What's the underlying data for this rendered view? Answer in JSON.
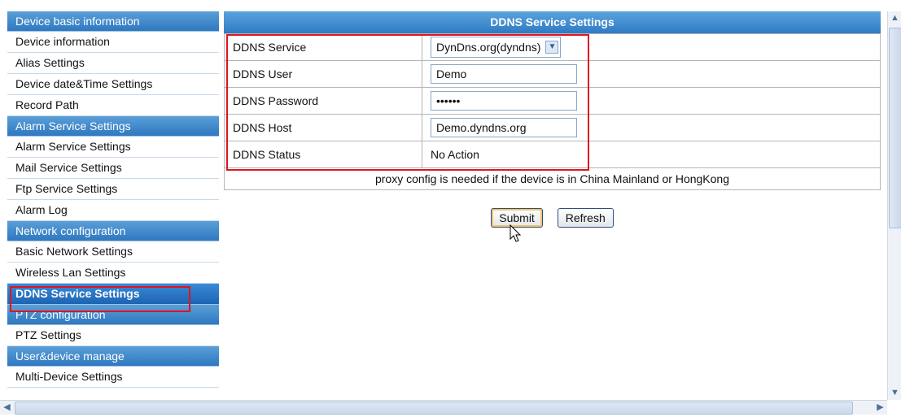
{
  "sidebar": {
    "sections": [
      {
        "header": "Device basic information",
        "items": [
          "Device information",
          "Alias Settings",
          "Device date&Time Settings",
          "Record Path"
        ]
      },
      {
        "header": "Alarm Service Settings",
        "items": [
          "Alarm Service Settings",
          "Mail Service Settings",
          "Ftp Service Settings",
          "Alarm Log"
        ]
      },
      {
        "header": "Network configuration",
        "items": [
          "Basic Network Settings",
          "Wireless Lan Settings",
          "DDNS Service Settings"
        ]
      },
      {
        "header": "PTZ configuration",
        "items": [
          "PTZ Settings"
        ]
      },
      {
        "header": "User&device manage",
        "items": [
          "Multi-Device Settings"
        ]
      }
    ],
    "active_item": "DDNS Service Settings"
  },
  "main": {
    "title": "DDNS Service Settings",
    "rows": {
      "service": {
        "label": "DDNS Service",
        "value": "DynDns.org(dyndns)"
      },
      "user": {
        "label": "DDNS User",
        "value": "Demo"
      },
      "password": {
        "label": "DDNS Password",
        "value": "••••••"
      },
      "host": {
        "label": "DDNS Host",
        "value": "Demo.dyndns.org"
      },
      "status": {
        "label": "DDNS Status",
        "value": "No Action"
      }
    },
    "note": "proxy config is needed if the device is in China Mainland or HongKong",
    "buttons": {
      "submit": "Submit",
      "refresh": "Refresh"
    }
  },
  "icons": {
    "dropdown": "chevron-down-icon",
    "scroll_up": "scroll-up-arrow-icon",
    "scroll_down": "scroll-down-arrow-icon",
    "scroll_left": "scroll-left-arrow-icon",
    "scroll_right": "scroll-right-arrow-icon",
    "cursor": "mouse-pointer-icon"
  },
  "colors": {
    "header_blue": "#2f7bc4",
    "highlight_red": "#e0141e",
    "active_item_bg": "#1d64b3"
  }
}
